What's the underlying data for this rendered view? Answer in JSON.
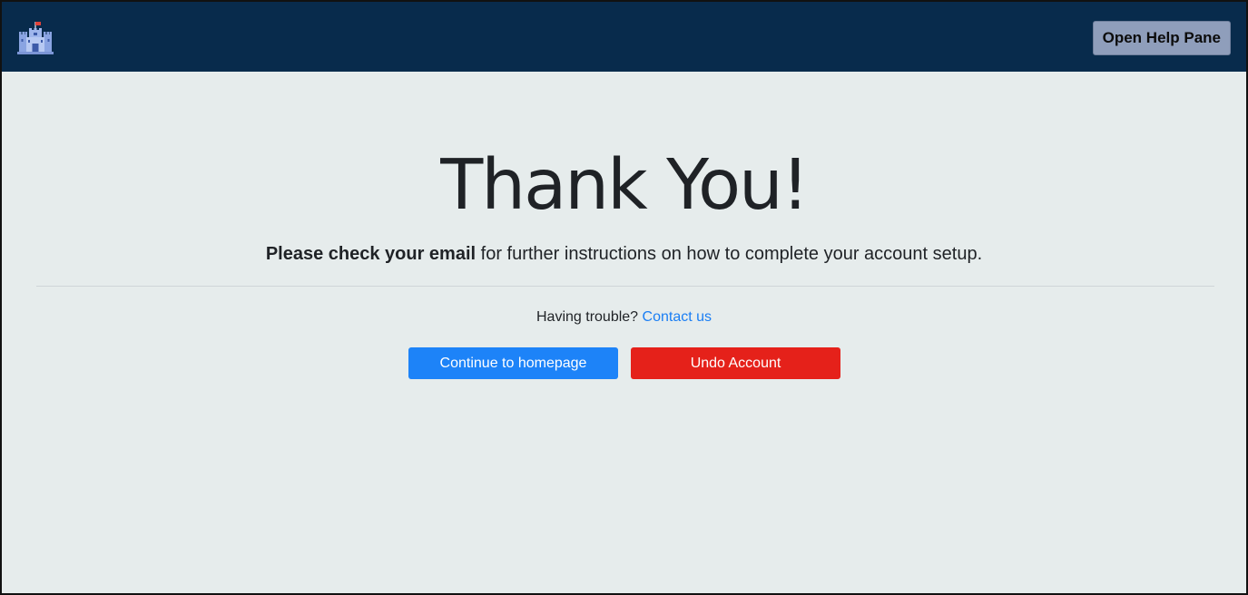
{
  "header": {
    "logo_icon": "castle-icon",
    "help_button_label": "Open Help Pane"
  },
  "main": {
    "title": "Thank You!",
    "subtitle_bold": "Please check your email",
    "subtitle_rest": " for further instructions on how to complete your account setup.",
    "trouble_text": "Having trouble? ",
    "contact_link": "Contact us",
    "continue_button_label": "Continue to homepage",
    "undo_button_label": "Undo Account"
  },
  "colors": {
    "header_background": "#082b4c",
    "page_background": "#e6ecec",
    "primary_button": "#1d83f8",
    "danger_button": "#e5211a",
    "link": "#1a7ef4",
    "help_button": "#8f9ebb"
  }
}
